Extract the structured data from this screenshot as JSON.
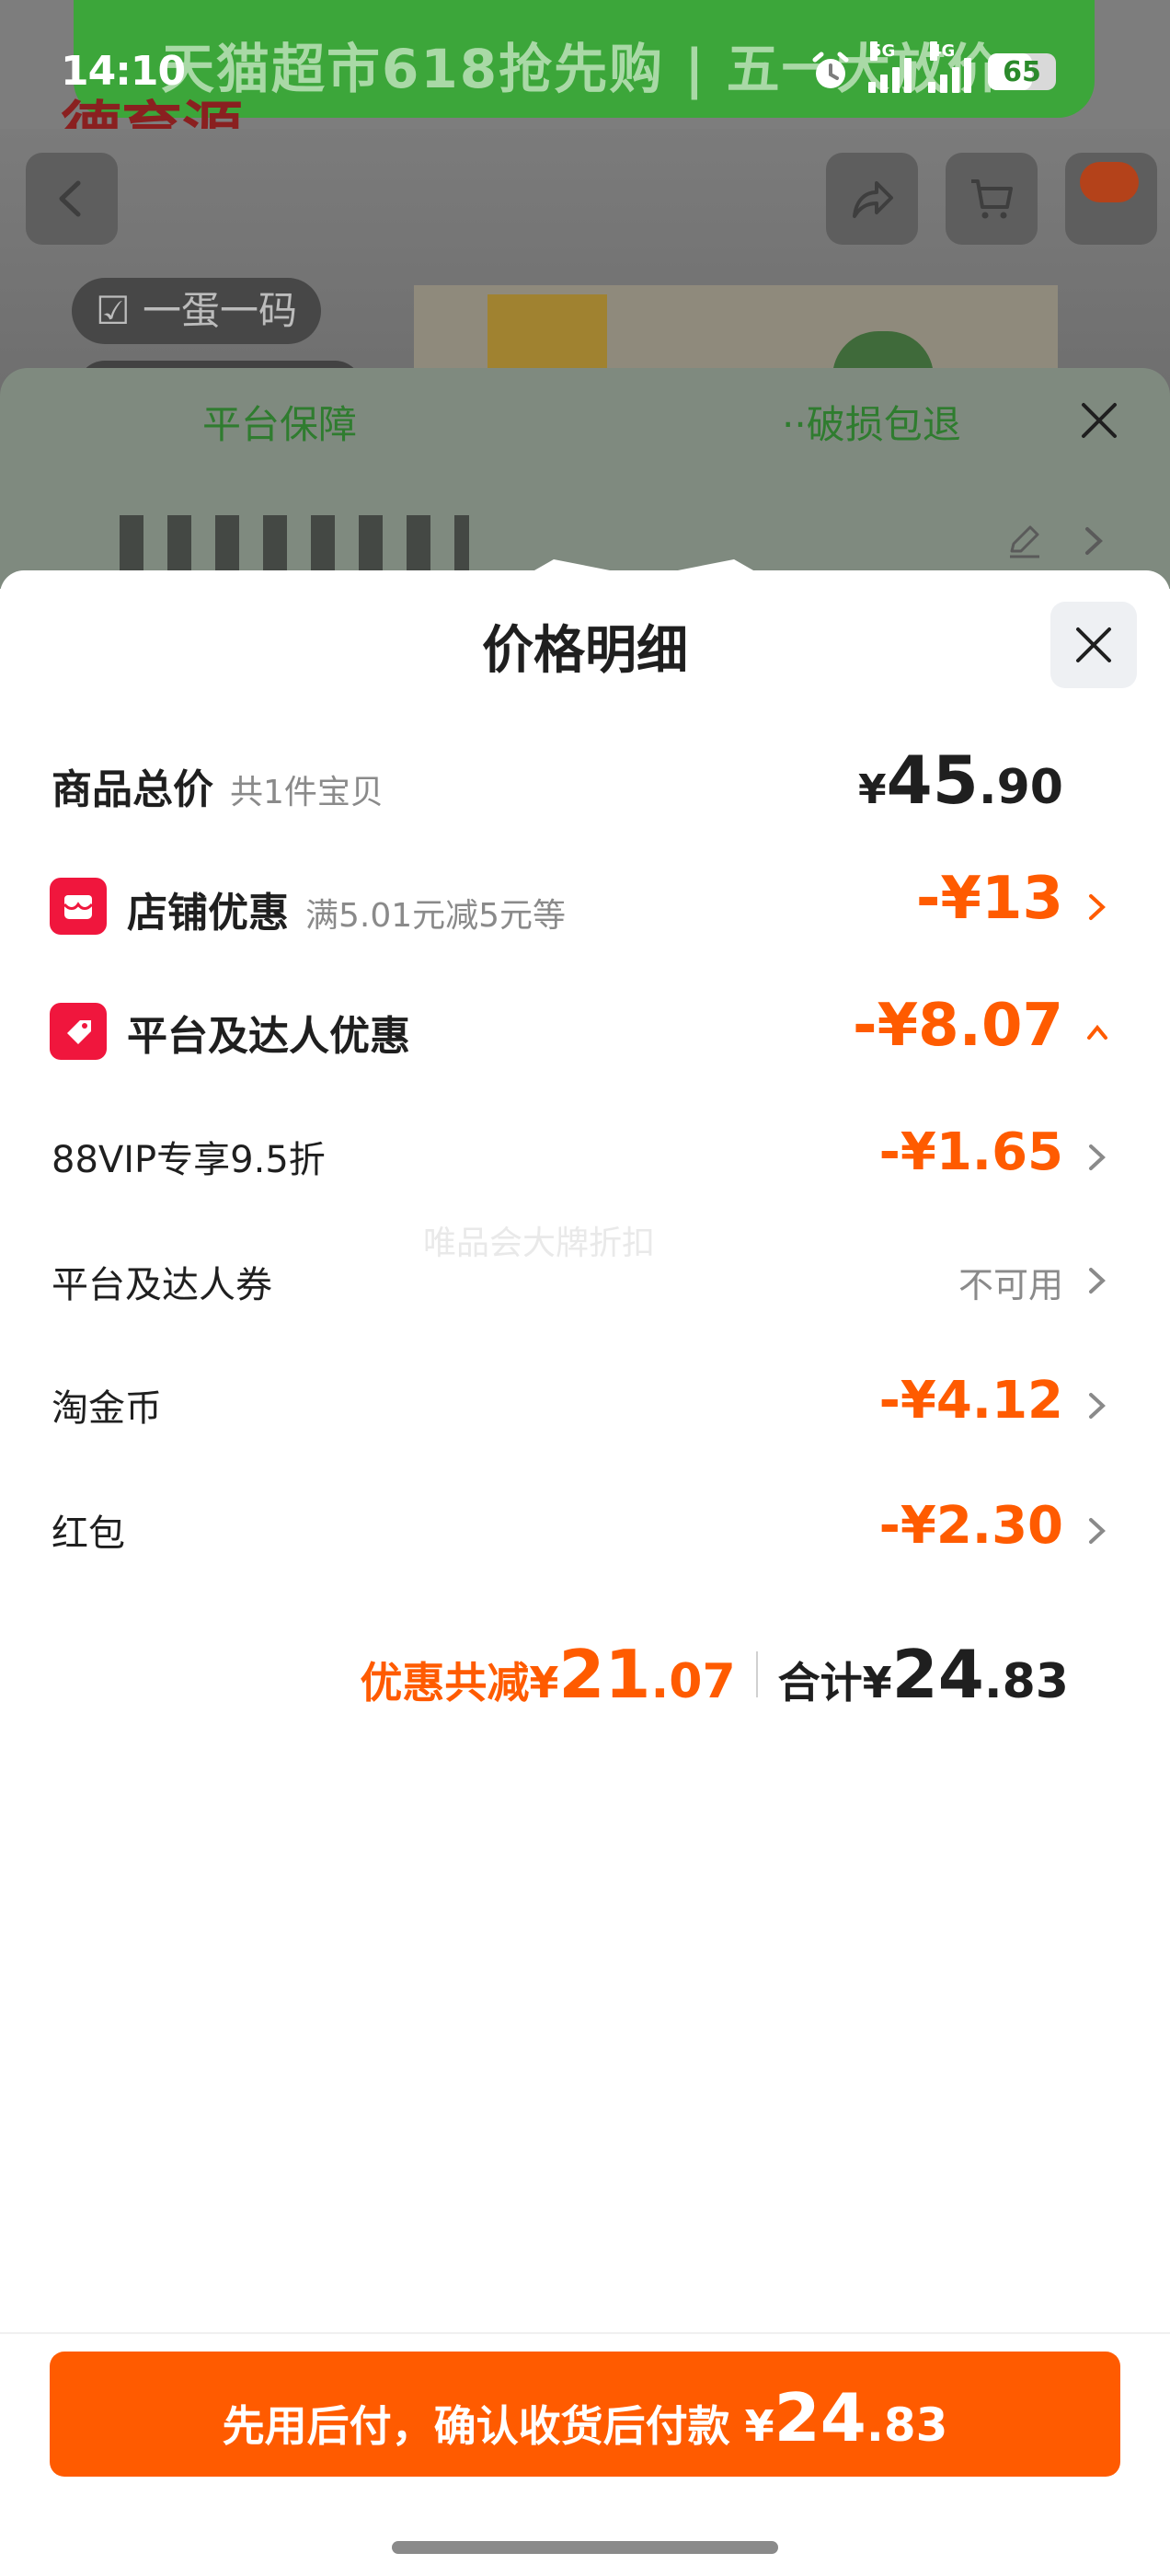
{
  "status_bar": {
    "time": "14:10",
    "network_1": "5G",
    "network_2": "4G",
    "battery": "65",
    "battery_level": 0.65
  },
  "background": {
    "banner_text": "天猫超市618抢先购 | 五一大放价",
    "logo_text": "德育源",
    "tag": "☑ 一蛋一码",
    "guarantee_left": "平台保障",
    "guarantee_right": "··破损包退"
  },
  "sheet": {
    "title": "价格明细",
    "rows": {
      "total": {
        "label": "商品总价",
        "sub": "共1件宝贝",
        "currency": "¥",
        "int": "45",
        "dec": ".90"
      },
      "shop": {
        "label": "店铺优惠",
        "sub": "满5.01元减5元等",
        "amount": "-¥13"
      },
      "platform": {
        "label": "平台及达人优惠",
        "amount": "-¥8.07"
      },
      "vip": {
        "label": "88VIP专享9.5折",
        "amount": "-¥1.65"
      },
      "coupon": {
        "label": "平台及达人券",
        "amount": "不可用"
      },
      "coins": {
        "label": "淘金币",
        "amount": "-¥4.12"
      },
      "redpacket": {
        "label": "红包",
        "amount": "-¥2.30"
      }
    },
    "watermark": "唯品会大牌折扣",
    "summary": {
      "discount_label": "优惠共减¥",
      "discount_int": "21",
      "discount_dec": ".07",
      "total_label": "合计¥",
      "total_int": "24",
      "total_dec": ".83"
    },
    "pay_button": {
      "label": "先用后付，确认收货后付款 ¥",
      "int": "24",
      "dec": ".83"
    }
  },
  "colors": {
    "accent": "#ff5b00",
    "badge": "#f0163d",
    "text": "#1f1f1f",
    "muted": "#8a8a8a"
  },
  "icons": [
    "alarm-icon",
    "signal-icon",
    "battery-icon",
    "back-icon",
    "share-icon",
    "cart-icon",
    "message-icon",
    "close-icon",
    "shop-icon",
    "tag-icon",
    "chevron-right-icon",
    "chevron-up-icon",
    "edit-icon"
  ]
}
